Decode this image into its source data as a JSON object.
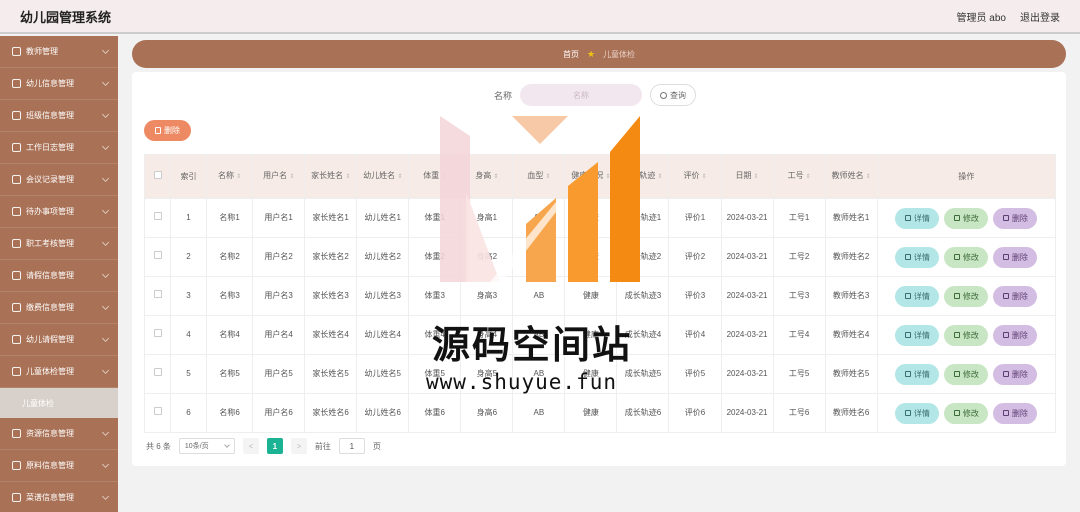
{
  "app": {
    "title": "幼儿园管理系统",
    "user": "管理员 abo",
    "logout": "退出登录"
  },
  "sidebar": {
    "items": [
      {
        "label": "教师管理"
      },
      {
        "label": "幼儿信息管理"
      },
      {
        "label": "班级信息管理"
      },
      {
        "label": "工作日志管理"
      },
      {
        "label": "会议记录管理"
      },
      {
        "label": "待办事项管理"
      },
      {
        "label": "职工考核管理"
      },
      {
        "label": "请假信息管理"
      },
      {
        "label": "缴费信息管理"
      },
      {
        "label": "幼儿请假管理"
      },
      {
        "label": "儿童体检管理"
      }
    ],
    "active_sub": "儿童体检",
    "items_after": [
      {
        "label": "资源信息管理"
      },
      {
        "label": "原料信息管理"
      },
      {
        "label": "菜谱信息管理"
      }
    ]
  },
  "breadcrumb": {
    "home": "首页",
    "current": "儿童体检"
  },
  "search": {
    "label": "名称",
    "placeholder": "名称",
    "button": "查询"
  },
  "bulk_delete": "删除",
  "table": {
    "columns": [
      "索引",
      "名称",
      "用户名",
      "家长姓名",
      "幼儿姓名",
      "体重",
      "身高",
      "血型",
      "健康状况",
      "成长轨迹",
      "评价",
      "日期",
      "工号",
      "教师姓名",
      "操作"
    ],
    "rows": [
      {
        "idx": "1",
        "name": "名称1",
        "user": "用户名1",
        "parent": "家长姓名1",
        "child": "幼儿姓名1",
        "weight": "体重1",
        "height": "身高1",
        "blood": "AB",
        "health": "健康",
        "growth": "成长轨迹1",
        "eval": "评价1",
        "date": "2024-03-21",
        "no": "工号1",
        "teacher": "教师姓名1"
      },
      {
        "idx": "2",
        "name": "名称2",
        "user": "用户名2",
        "parent": "家长姓名2",
        "child": "幼儿姓名2",
        "weight": "体重2",
        "height": "身高2",
        "blood": "AB",
        "health": "健康",
        "growth": "成长轨迹2",
        "eval": "评价2",
        "date": "2024-03-21",
        "no": "工号2",
        "teacher": "教师姓名2"
      },
      {
        "idx": "3",
        "name": "名称3",
        "user": "用户名3",
        "parent": "家长姓名3",
        "child": "幼儿姓名3",
        "weight": "体重3",
        "height": "身高3",
        "blood": "AB",
        "health": "健康",
        "growth": "成长轨迹3",
        "eval": "评价3",
        "date": "2024-03-21",
        "no": "工号3",
        "teacher": "教师姓名3"
      },
      {
        "idx": "4",
        "name": "名称4",
        "user": "用户名4",
        "parent": "家长姓名4",
        "child": "幼儿姓名4",
        "weight": "体重4",
        "height": "身高4",
        "blood": "AB",
        "health": "健康",
        "growth": "成长轨迹4",
        "eval": "评价4",
        "date": "2024-03-21",
        "no": "工号4",
        "teacher": "教师姓名4"
      },
      {
        "idx": "5",
        "name": "名称5",
        "user": "用户名5",
        "parent": "家长姓名5",
        "child": "幼儿姓名5",
        "weight": "体重5",
        "height": "身高5",
        "blood": "AB",
        "health": "健康",
        "growth": "成长轨迹5",
        "eval": "评价5",
        "date": "2024-03-21",
        "no": "工号5",
        "teacher": "教师姓名5"
      },
      {
        "idx": "6",
        "name": "名称6",
        "user": "用户名6",
        "parent": "家长姓名6",
        "child": "幼儿姓名6",
        "weight": "体重6",
        "height": "身高6",
        "blood": "AB",
        "health": "健康",
        "growth": "成长轨迹6",
        "eval": "评价6",
        "date": "2024-03-21",
        "no": "工号6",
        "teacher": "教师姓名6"
      }
    ],
    "actions": {
      "detail": "详情",
      "edit": "修改",
      "delete": "删除"
    }
  },
  "pagination": {
    "total": "共 6 条",
    "page_size": "10条/页",
    "prev": "<",
    "current": "1",
    "next": ">",
    "goto_label": "前往",
    "goto_value": "1",
    "goto_suffix": "页"
  },
  "watermark": {
    "text": "源码空间站",
    "url": "www.shuyue.fun"
  },
  "colors": {
    "brand": "#a97156",
    "accent": "#1bb394",
    "danger": "#ee8a63"
  }
}
